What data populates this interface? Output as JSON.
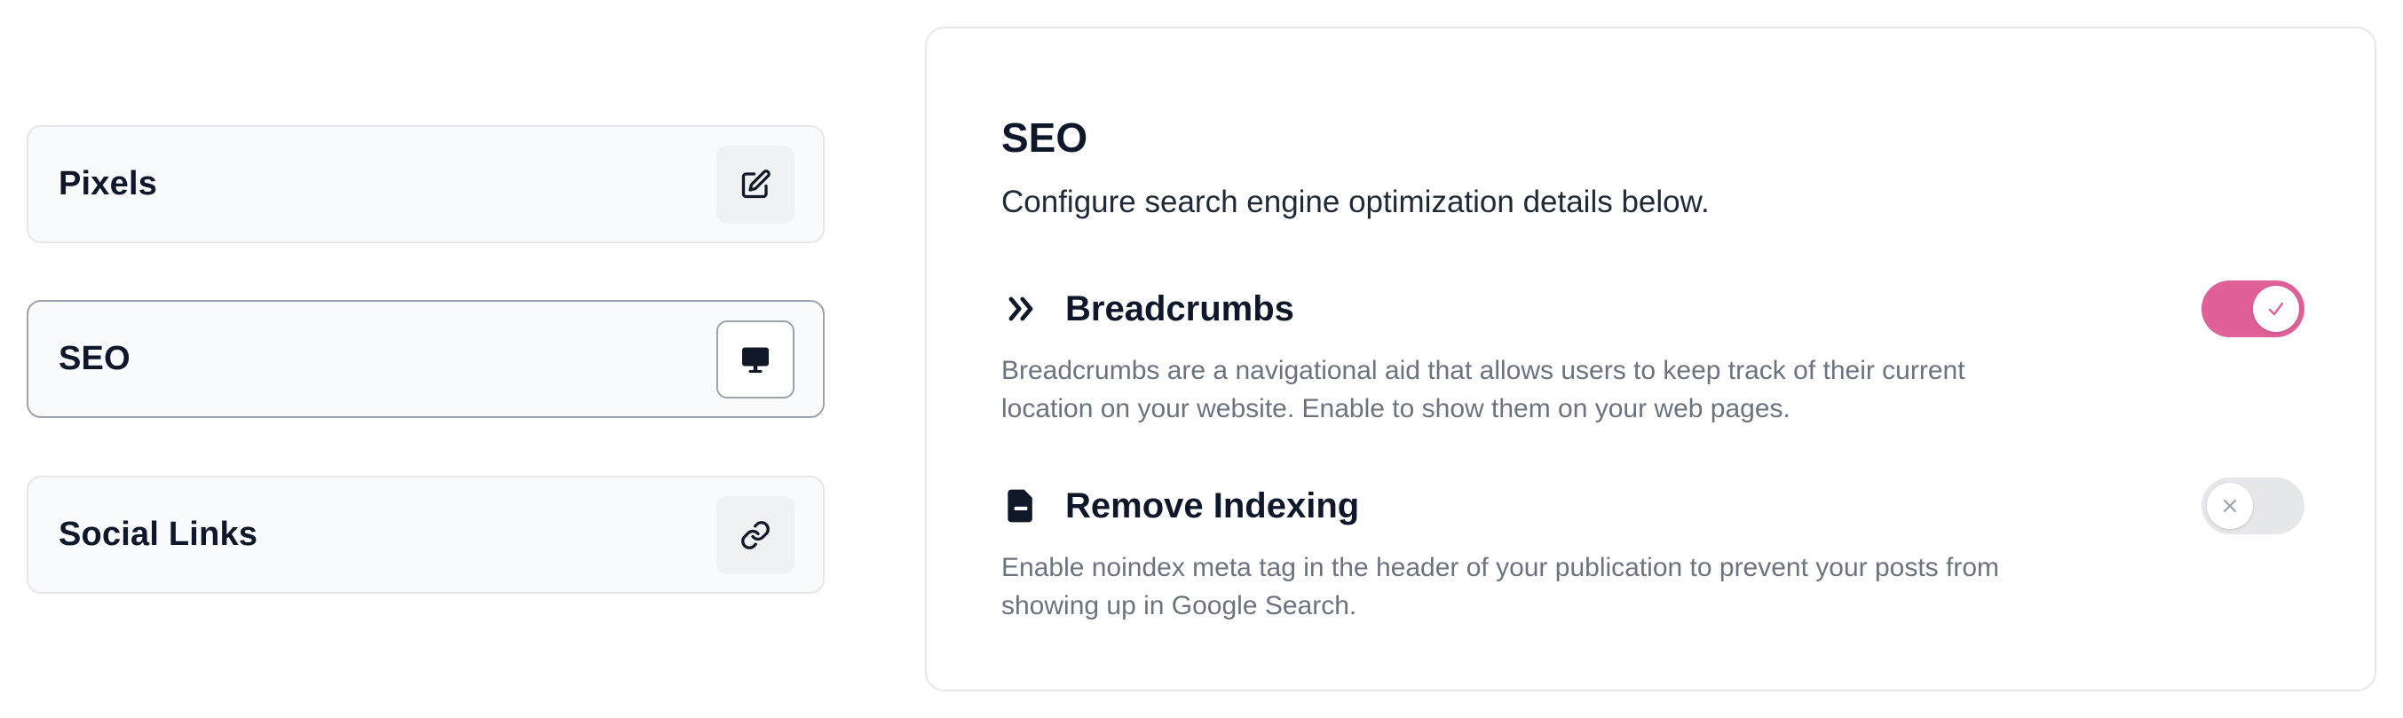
{
  "nav": {
    "items": [
      {
        "label": "Pixels",
        "icon": "edit-icon",
        "active": false
      },
      {
        "label": "SEO",
        "icon": "monitor-icon",
        "active": true
      },
      {
        "label": "Social Links",
        "icon": "link-icon",
        "active": false
      }
    ]
  },
  "panel": {
    "title": "SEO",
    "subtitle": "Configure search engine optimization details below.",
    "settings": [
      {
        "icon": "chevrons-right-icon",
        "title": "Breadcrumbs",
        "description": "Breadcrumbs are a navigational aid that allows users to keep track of their current location on your website. Enable to show them on your web pages.",
        "enabled": true
      },
      {
        "icon": "file-minus-icon",
        "title": "Remove Indexing",
        "description": "Enable noindex meta tag in the header of your publication to prevent your posts from showing up in Google Search.",
        "enabled": false
      }
    ]
  },
  "colors": {
    "toggle_on": "#e0609a",
    "toggle_off": "#e5e7eb",
    "text_primary": "#0f172a",
    "text_muted": "#6b7280",
    "border": "#e5e7eb"
  }
}
